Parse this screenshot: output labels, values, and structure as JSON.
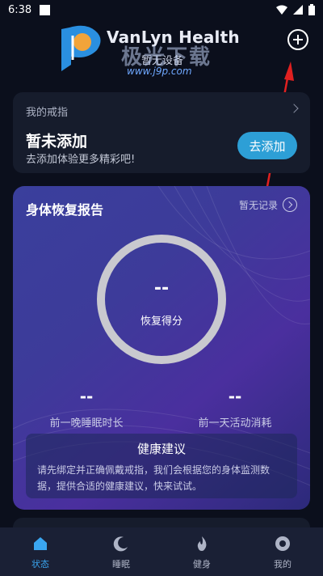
{
  "status_bar": {
    "time": "6:38"
  },
  "header": {
    "app_title": "VanLyn Health",
    "subtitle": "暂无设备",
    "watermark_text": "极光下载",
    "watermark_url": "www.j9p.com",
    "add_icon": "plus-circle-icon"
  },
  "ring_card": {
    "label": "我的戒指",
    "title": "暂未添加",
    "subtitle": "去添加体验更多精彩吧!",
    "add_button": "去添加"
  },
  "report": {
    "title": "身体恢复报告",
    "history_link": "暂无记录",
    "score_value": "--",
    "score_label": "恢复得分",
    "sleep_value": "--",
    "sleep_label": "前一晚睡眠时长",
    "activity_value": "--",
    "activity_label": "前一天活动消耗",
    "advice_title": "健康建议",
    "advice_body": "请先绑定并正确佩戴戒指，我们会根据您的身体监测数据，提供合适的健康建议，快来试试。"
  },
  "bottom_nav": {
    "items": [
      {
        "label": "状态",
        "icon": "home-icon",
        "active": true
      },
      {
        "label": "睡眠",
        "icon": "moon-icon",
        "active": false
      },
      {
        "label": "健身",
        "icon": "flame-icon",
        "active": false
      },
      {
        "label": "我的",
        "icon": "profile-icon",
        "active": false
      }
    ]
  },
  "colors": {
    "accent": "#2d9fd6",
    "nav_active": "#3aa6f0",
    "background": "#0b0f1c",
    "annotation_arrow": "#e02020"
  }
}
